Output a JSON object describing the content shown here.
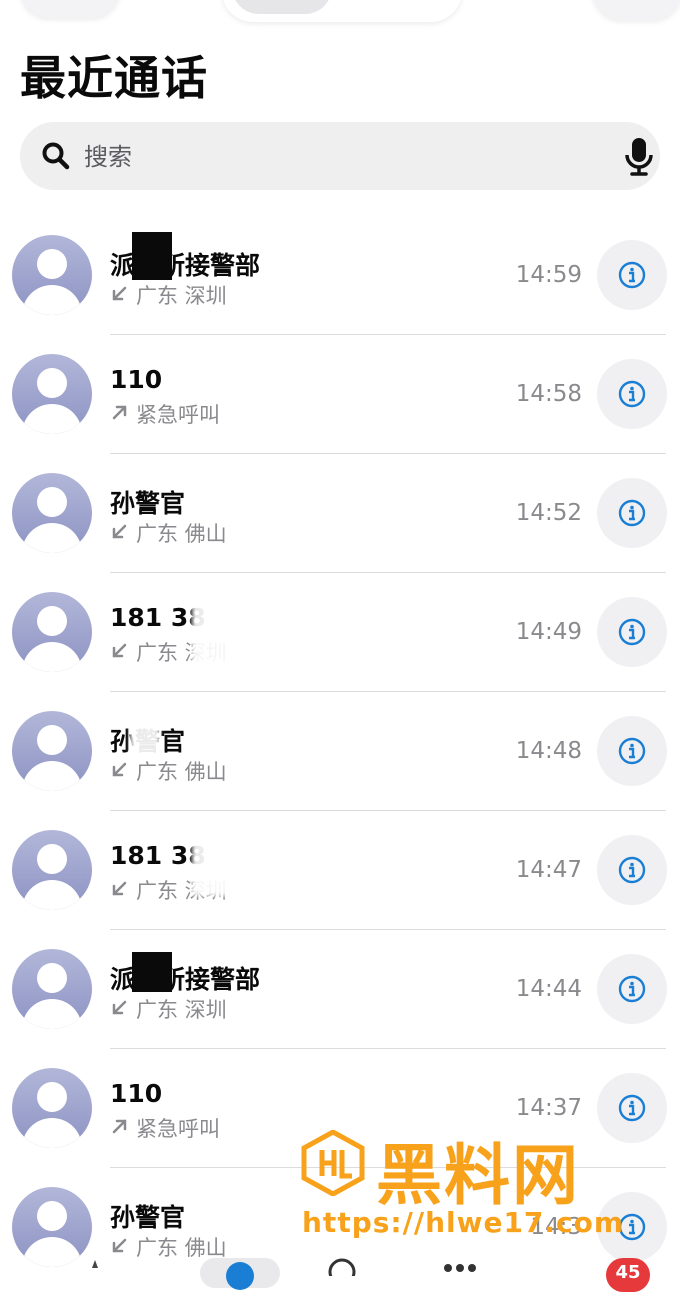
{
  "page_title": "最近通话",
  "search": {
    "placeholder": "搜索"
  },
  "calls": [
    {
      "name": "派出所接警部",
      "direction": "incoming",
      "location": "广东 深圳",
      "time": "14:59"
    },
    {
      "name": "110",
      "direction": "outgoing",
      "location": "紧急呼叫",
      "time": "14:58"
    },
    {
      "name": "孙警官",
      "direction": "incoming",
      "location": "广东 佛山",
      "time": "14:52"
    },
    {
      "name": "181 38",
      "direction": "incoming",
      "location": "广东 深圳",
      "time": "14:49"
    },
    {
      "name": "孙警官",
      "direction": "incoming",
      "location": "广东 佛山",
      "time": "14:48"
    },
    {
      "name": "181 38",
      "direction": "incoming",
      "location": "广东 深圳",
      "time": "14:47"
    },
    {
      "name": "派出所接警部",
      "direction": "incoming",
      "location": "广东 深圳",
      "time": "14:44"
    },
    {
      "name": "110",
      "direction": "outgoing",
      "location": "紧急呼叫",
      "time": "14:37"
    },
    {
      "name": "孙警官",
      "direction": "incoming",
      "location": "广东 佛山",
      "time": "14:3"
    }
  ],
  "tabbar": {
    "badge": "45"
  },
  "watermark": {
    "title": "黑料网",
    "url": "https://hlwe17.com"
  },
  "colors": {
    "accent": "#1a7fd4",
    "badge": "#e5393c",
    "watermark": "#f7a21a"
  }
}
